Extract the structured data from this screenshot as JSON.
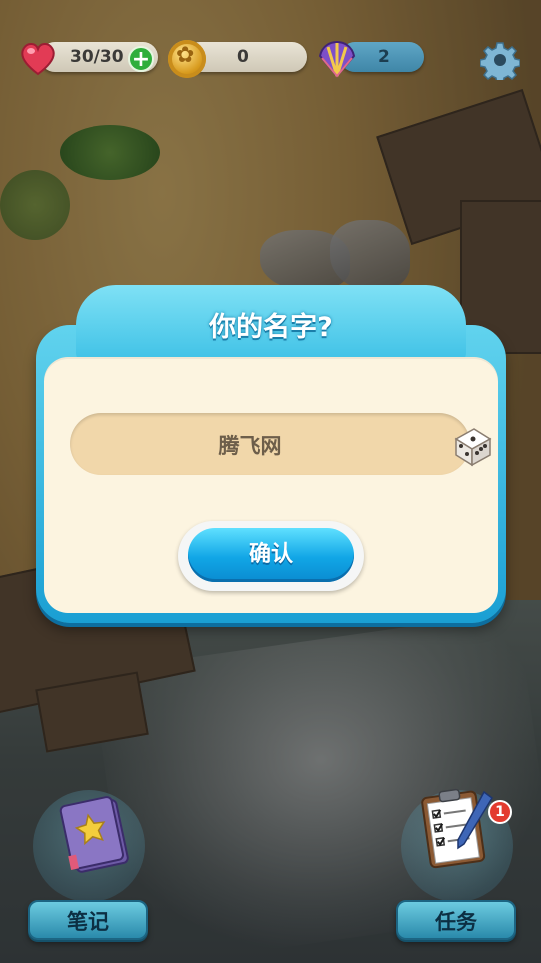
{
  "hud": {
    "lives": "30/30",
    "coins": "0",
    "shells": "2"
  },
  "dialog": {
    "title": "你的名字?",
    "name_value": "腾飞网",
    "confirm_label": "确认"
  },
  "bottom": {
    "notes_label": "笔记",
    "tasks_label": "任务",
    "tasks_badge": "1"
  },
  "icons": [
    "heart-icon",
    "plus-icon",
    "coin-icon",
    "shell-icon",
    "gear-icon",
    "dice-icon",
    "notebook-icon",
    "clipboard-icon"
  ],
  "colors": {
    "dialog_frame": "#1a9fd3",
    "dialog_body": "#fcf4e0",
    "name_field": "#f1d7aa",
    "confirm_button": "#11a6e6",
    "badge": "#e33b2f"
  }
}
